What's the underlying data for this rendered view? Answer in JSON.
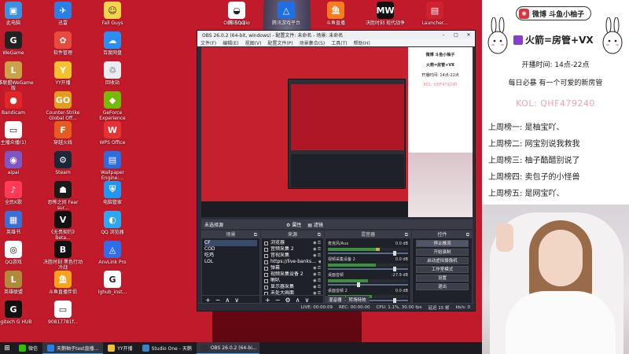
{
  "desktop": {
    "icons": [
      {
        "label": "此电脑",
        "color": "#3d8fe0",
        "glyph": "▣"
      },
      {
        "label": "迅雷",
        "color": "#2a7fe6",
        "glyph": "✈"
      },
      {
        "label": "Fall Guys",
        "color": "#f3d44a",
        "glyph": "☺"
      },
      {
        "label": "WeGame",
        "color": "#222222",
        "glyph": "G"
      },
      {
        "label": "软件管理",
        "color": "#e84b3c",
        "glyph": "✿"
      },
      {
        "label": "百度网盘",
        "color": "#2a8ef5",
        "glyph": "☁"
      },
      {
        "label": "英雄联盟WeGame版",
        "color": "#c9a24a",
        "glyph": "L"
      },
      {
        "label": "YY开播",
        "color": "#f5c12e",
        "glyph": "Y"
      },
      {
        "label": "回收站",
        "color": "#e9edf2",
        "glyph": "♲"
      },
      {
        "label": "Bandicam",
        "color": "#e02727",
        "glyph": "●"
      },
      {
        "label": "Counter-Strike Global Off...",
        "color": "#e39d1d",
        "glyph": "GO"
      },
      {
        "label": "GeForce Experience",
        "color": "#76b900",
        "glyph": "◆"
      },
      {
        "label": "主播众播(1)",
        "color": "#ffffff",
        "glyph": "▭"
      },
      {
        "label": "穿越火线",
        "color": "#e65b1e",
        "glyph": "F"
      },
      {
        "label": "WPS Office",
        "color": "#e63232",
        "glyph": "W"
      },
      {
        "label": "aipai",
        "color": "#7e57c2",
        "glyph": "◉"
      },
      {
        "label": "Steam",
        "color": "#1b2838",
        "glyph": "⚙"
      },
      {
        "label": "Wallpaper Engine:...",
        "color": "#2d6cdf",
        "glyph": "▤"
      },
      {
        "label": "全民K歌",
        "color": "#ff3b55",
        "glyph": "♪"
      },
      {
        "label": "恐怖之间 Fear sur...",
        "color": "#1a1a1a",
        "glyph": "☗"
      },
      {
        "label": "电脑管家",
        "color": "#2196f3",
        "glyph": "⛨"
      },
      {
        "label": "英雄书",
        "color": "#3b6fd6",
        "glyph": "▦"
      },
      {
        "label": "《无畏契约》Beta...",
        "color": "#111111",
        "glyph": "V"
      },
      {
        "label": "QQ 浏览器",
        "color": "#2ea7f2",
        "glyph": "◐"
      },
      {
        "label": "QQ游戏",
        "color": "#ffffff",
        "glyph": "◎"
      },
      {
        "label": "决胜时刻 黑色行动冷战",
        "color": "#111111",
        "glyph": "B"
      },
      {
        "label": "AnvLink Pro",
        "color": "#2f6ee8",
        "glyph": "◬"
      },
      {
        "label": "英雄联盟",
        "color": "#b08a3c",
        "glyph": "L"
      },
      {
        "label": "斗鱼直播伴侣",
        "color": "#f6a21e",
        "glyph": "鱼"
      },
      {
        "label": "lghub_inst...",
        "color": "#ffffff",
        "glyph": "G"
      },
      {
        "label": "Logitech G HUB",
        "color": "#111111",
        "glyph": "G"
      },
      {
        "label": "90817781f...",
        "color": "#ffffff",
        "glyph": "▭"
      }
    ],
    "top_icons": [
      {
        "label": "OBS Studio",
        "color": "#303036",
        "glyph": "◎"
      },
      {
        "label": "腾讯QQ",
        "color": "#ffffff",
        "glyph": "◒"
      },
      {
        "label": "腾讯游戏平台",
        "color": "#1f6fe4",
        "glyph": "△"
      },
      {
        "label": "斗鱼直播",
        "color": "#f67d1e",
        "glyph": "鱼"
      },
      {
        "label": "决胜时刻 现代战争",
        "color": "#111111",
        "glyph": "MW"
      },
      {
        "label": "Launcher...",
        "color": "#d1202e",
        "glyph": "▤"
      }
    ]
  },
  "obs": {
    "title": "OBS 26.0.2 (64-bit, windows) - 配置文件: 未命名 - 场景: 未命名",
    "menu": [
      "文件(F)",
      "编辑(E)",
      "视图(V)",
      "配置文件(P)",
      "场景集合(S)",
      "工具(T)",
      "帮助(H)"
    ],
    "scene_bar": {
      "left": "未选择源",
      "props": "属性",
      "filters": "滤镜"
    },
    "docks": {
      "scenes": {
        "title": "场景",
        "items": [
          "CF",
          "COD",
          "吃鸡",
          "LOL"
        ]
      },
      "sources": {
        "title": "来源",
        "items": [
          "浏览器",
          "音频采集 2",
          "音视采集",
          "https://live-banks...",
          "弹幕",
          "视频采集设备 2",
          "喇叭",
          "显示器采集",
          "未处大画面"
        ]
      },
      "mixer": {
        "title": "混音器",
        "channels": [
          {
            "name": "麦克风/Aux",
            "db": "0.0 dB",
            "level": 0.65,
            "volume": 0.9
          },
          {
            "name": "视频采集设备 2",
            "db": "0.0 dB",
            "level": 0.6,
            "volume": 0.9
          },
          {
            "name": "桌面音频",
            "db": "-27.9 dB",
            "level": 0.5,
            "volume": 0.4
          },
          {
            "name": "桌面音频 2",
            "db": "0.0 dB",
            "level": 0.55,
            "volume": 0.9
          }
        ],
        "tabs": [
          "混音器",
          "转场特效"
        ]
      },
      "controls": {
        "title": "控件",
        "buttons": [
          "停止推流",
          "开始录制",
          "启动虚拟摄像机",
          "工作室模式",
          "设置",
          "退出"
        ]
      }
    },
    "status": {
      "live": "LIVE: 00:00:09",
      "rec": "REC: 00:00:00",
      "cpu": "CPU: 1.1%, 30.00 fps",
      "frames": "延迟 15 帧",
      "kbs": "kb/s: 0"
    }
  },
  "panel": {
    "brand": "微博 斗鱼小柚子",
    "contact": "火箭=房管+VX",
    "hours": "开播时间: 14点-22点",
    "tagline": "每日必暴 有一个可爱的新房管",
    "kol": "KOL: QHF479240",
    "ranking": [
      "上周榜一: 是柚宝吖、",
      "上周榜二: 网宝别说我救我",
      "上周榜三: 柚子酷醋别说了",
      "上周榜四: 卖包子的小怪兽",
      "上周榜五: 是网宝吖、"
    ]
  },
  "taskbar": {
    "start_glyph": "⊞",
    "tasks": [
      {
        "label": "微信",
        "color": "#2dc100",
        "active": false
      },
      {
        "label": "天鹅柚子test直播...",
        "color": "#2a7fe6",
        "active": true
      },
      {
        "label": "YY开播",
        "color": "#f5c12e",
        "active": false
      },
      {
        "label": "Studio One - 天鹅",
        "color": "#3a82c4",
        "active": false
      },
      {
        "label": "OBS 26.0.2 (64-bi...",
        "color": "#303036",
        "active": true
      }
    ]
  }
}
